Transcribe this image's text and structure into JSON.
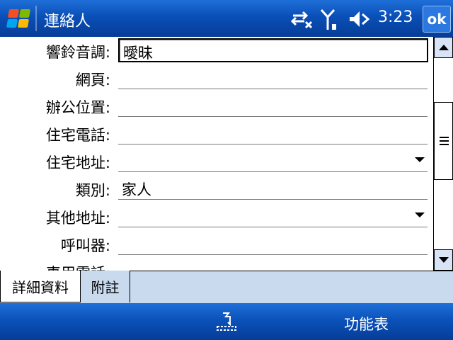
{
  "window": {
    "title": "連絡人",
    "ok_label": "ok",
    "clock": "3:23"
  },
  "status_icons": [
    "connectivity-icon",
    "signal-icon",
    "speaker-icon"
  ],
  "form": {
    "rows": [
      {
        "label": "響鈴音調:",
        "value": "曖昧",
        "type": "dropdown",
        "active": true
      },
      {
        "label": "網頁:",
        "value": "",
        "type": "text"
      },
      {
        "label": "辦公位置:",
        "value": "",
        "type": "text"
      },
      {
        "label": "住宅電話:",
        "value": "",
        "type": "text"
      },
      {
        "label": "住宅地址:",
        "value": "",
        "type": "dropdown"
      },
      {
        "label": "類別:",
        "value": "家人",
        "type": "text"
      },
      {
        "label": "其他地址:",
        "value": "",
        "type": "dropdown"
      },
      {
        "label": "呼叫器:",
        "value": "",
        "type": "text"
      },
      {
        "label": "車用電話:",
        "value": "",
        "type": "text"
      }
    ]
  },
  "tabs": [
    {
      "label": "詳細資料",
      "selected": true
    },
    {
      "label": "附註",
      "selected": false
    }
  ],
  "menubar": {
    "right_label": "功能表",
    "center_icon": "keyboard-icon"
  },
  "colors": {
    "titlebar": "#0a4fb8",
    "tabstrip": "#c9d9ee"
  }
}
